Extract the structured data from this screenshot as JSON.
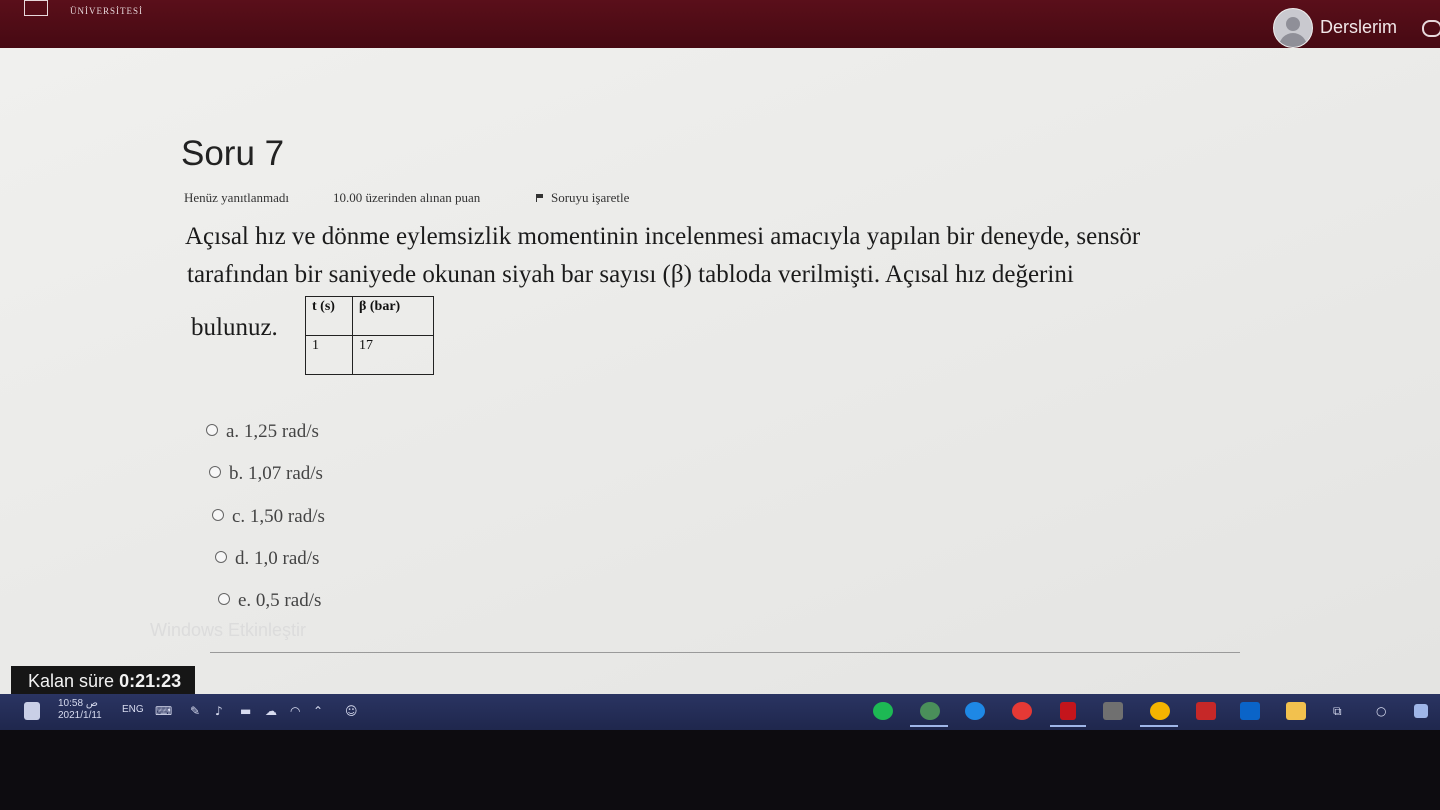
{
  "header": {
    "logo_text": "ÜNİVERSİTESİ",
    "user_label": "Derslerim"
  },
  "question": {
    "title": "Soru 7",
    "status": "Henüz yanıtlanmadı",
    "points": "10.00 üzerinden alınan puan",
    "flag_label": "Soruyu işaretle",
    "text_line1": "Açısal hız ve dönme eylemsizlik momentinin incelenmesi amacıyla yapılan bir deneyde, sensör",
    "text_line2": "tarafından bir saniyede okunan siyah bar sayısı (β) tabloda verilmişti. Açısal hız değerini",
    "text_line3": "bulunuz.",
    "table": {
      "headers": [
        "t (s)",
        "β (bar)"
      ],
      "row": [
        "1",
        "17"
      ]
    },
    "options": [
      "a. 1,25 rad/s",
      "b. 1,07 rad/s",
      "c. 1,50 rad/s",
      "d. 1,0 rad/s",
      "e. 0,5 rad/s"
    ]
  },
  "watermark": "Windows Etkinleştir",
  "timer": {
    "label": "Kalan süre",
    "value": "0:21:23"
  },
  "taskbar": {
    "time": "10:58 ص",
    "date": "2021/1/11",
    "lang": "ENG",
    "app_colors": {
      "spotify": "#1db954",
      "edge": "#1e88e5",
      "media": "#e53935",
      "netflix": "#c4151c",
      "store": "#707070",
      "chrome": "#f4b400",
      "mail": "#0a64c8",
      "folder": "#f2c14e"
    }
  }
}
